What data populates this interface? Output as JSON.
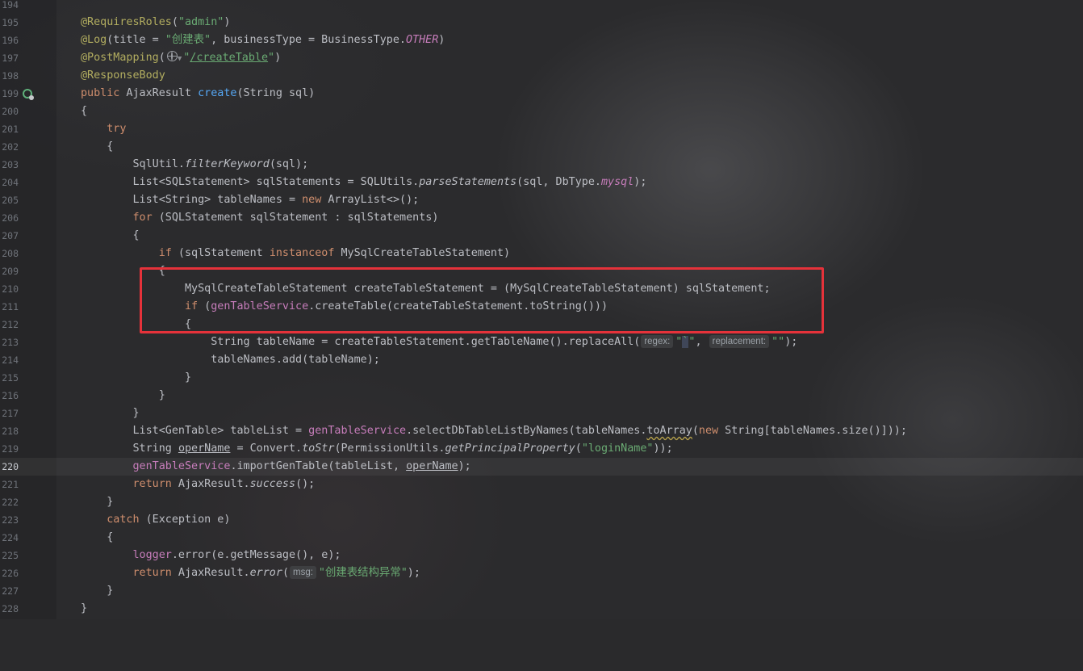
{
  "editor": {
    "language": "java",
    "current_line": "220",
    "lines": [
      {
        "n": "194",
        "text": ""
      },
      {
        "n": "195",
        "text": "@RequiresRoles(\"admin\")"
      },
      {
        "n": "196",
        "text": "@Log(title = \"创建表\", businessType = BusinessType.OTHER)"
      },
      {
        "n": "197",
        "text": "@PostMapping(\"/createTable\")"
      },
      {
        "n": "198",
        "text": "@ResponseBody"
      },
      {
        "n": "199",
        "text": "public AjaxResult create(String sql)"
      },
      {
        "n": "200",
        "text": "{"
      },
      {
        "n": "201",
        "text": "try"
      },
      {
        "n": "202",
        "text": "{"
      },
      {
        "n": "203",
        "text": "SqlUtil.filterKeyword(sql);"
      },
      {
        "n": "204",
        "text": "List<SQLStatement> sqlStatements = SQLUtils.parseStatements(sql, DbType.mysql);"
      },
      {
        "n": "205",
        "text": "List<String> tableNames = new ArrayList<>();"
      },
      {
        "n": "206",
        "text": "for (SQLStatement sqlStatement : sqlStatements)"
      },
      {
        "n": "207",
        "text": "{"
      },
      {
        "n": "208",
        "text": "if (sqlStatement instanceof MySqlCreateTableStatement)"
      },
      {
        "n": "209",
        "text": "{"
      },
      {
        "n": "210",
        "text": "MySqlCreateTableStatement createTableStatement = (MySqlCreateTableStatement) sqlStatement;"
      },
      {
        "n": "211",
        "text": "if (genTableService.createTable(createTableStatement.toString()))"
      },
      {
        "n": "212",
        "text": "{"
      },
      {
        "n": "213",
        "text": "String tableName = createTableStatement.getTableName().replaceAll(\"`\", \"\");"
      },
      {
        "n": "214",
        "text": "tableNames.add(tableName);"
      },
      {
        "n": "215",
        "text": "}"
      },
      {
        "n": "216",
        "text": "}"
      },
      {
        "n": "217",
        "text": "}"
      },
      {
        "n": "218",
        "text": "List<GenTable> tableList = genTableService.selectDbTableListByNames(tableNames.toArray(new String[tableNames.size()]));"
      },
      {
        "n": "219",
        "text": "String operName = Convert.toStr(PermissionUtils.getPrincipalProperty(\"loginName\"));"
      },
      {
        "n": "220",
        "text": "genTableService.importGenTable(tableList, operName);"
      },
      {
        "n": "221",
        "text": "return AjaxResult.success();"
      },
      {
        "n": "222",
        "text": "}"
      },
      {
        "n": "223",
        "text": "catch (Exception e)"
      },
      {
        "n": "224",
        "text": "{"
      },
      {
        "n": "225",
        "text": "logger.error(e.getMessage(), e);"
      },
      {
        "n": "226",
        "text": "return AjaxResult.error(\"创建表结构异常\");"
      },
      {
        "n": "227",
        "text": "}"
      },
      {
        "n": "228",
        "text": "}"
      }
    ],
    "hints": {
      "regex": "regex:",
      "replacement": "replacement:",
      "msg": "msg:"
    }
  },
  "icons": {
    "gutter": "run-gutter-icon",
    "url": "globe-icon"
  },
  "colors": {
    "highlight_box": "#e5323a",
    "keyword": "#cf8e6d",
    "string": "#6aab73",
    "annotation": "#b3ae60",
    "field": "#c77dbb",
    "method_decl": "#56a8f5"
  }
}
